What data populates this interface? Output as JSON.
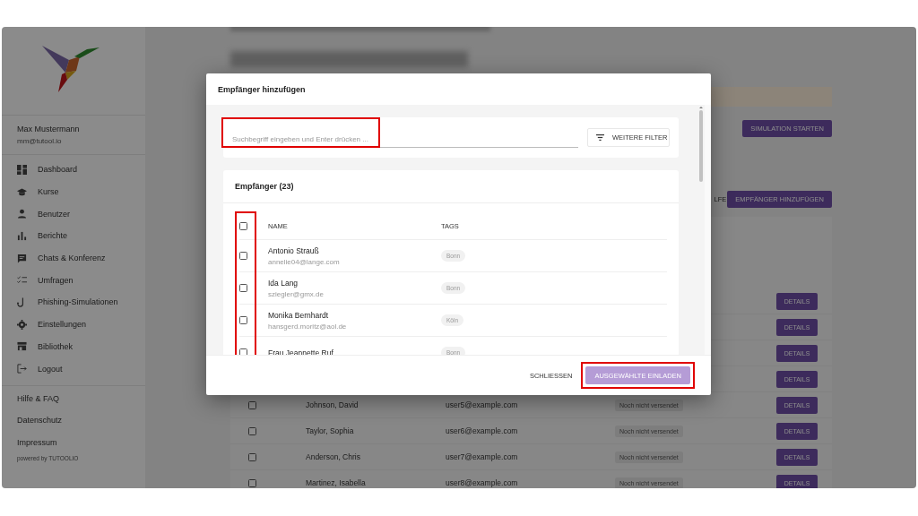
{
  "sidebar": {
    "user": {
      "name": "Max Mustermann",
      "email": "mm@tutool.io"
    },
    "nav": [
      {
        "label": "Dashboard"
      },
      {
        "label": "Kurse"
      },
      {
        "label": "Benutzer"
      },
      {
        "label": "Berichte"
      },
      {
        "label": "Chats & Konferenz"
      },
      {
        "label": "Umfragen"
      },
      {
        "label": "Phishing-Simulationen"
      },
      {
        "label": "Einstellungen"
      },
      {
        "label": "Bibliothek"
      },
      {
        "label": "Logout"
      }
    ],
    "footer_links": [
      "Hilfe & FAQ",
      "Datenschutz",
      "Impressum"
    ],
    "powered_by": "powered by TUTOOLIO"
  },
  "page": {
    "start_button": "SIMULATION STARTEN",
    "help_link_fragment": "LFE",
    "add_button": "EMPFÄNGER HINZUFÜGEN",
    "rows": [
      {
        "action": "DETAILS"
      },
      {
        "action": "DETAILS"
      },
      {
        "action": "DETAILS"
      },
      {
        "action": "DETAILS"
      },
      {
        "checked": false,
        "name": "Johnson, David",
        "email": "user5@example.com",
        "status": "Noch nicht versendet",
        "action": "DETAILS"
      },
      {
        "checked": false,
        "name": "Taylor, Sophia",
        "email": "user6@example.com",
        "status": "Noch nicht versendet",
        "action": "DETAILS"
      },
      {
        "checked": false,
        "name": "Anderson, Chris",
        "email": "user7@example.com",
        "status": "Noch nicht versendet",
        "action": "DETAILS"
      },
      {
        "checked": false,
        "name": "Martinez, Isabella",
        "email": "user8@example.com",
        "status": "Noch nicht versendet",
        "action": "DETAILS"
      }
    ]
  },
  "dialog": {
    "title": "Empfänger hinzufügen",
    "search": {
      "placeholder": "Suchbegriff eingeben und Enter drücken ..."
    },
    "filter_button": "WEITERE FILTER",
    "recipients": {
      "title": "Empfänger (23)",
      "select_all": {
        "checked": false
      },
      "columns": [
        "NAME",
        "TAGS"
      ],
      "rows": [
        {
          "checked": false,
          "name": "Antonio Strauß",
          "email": "annelie04@lange.com",
          "tag": "Bonn"
        },
        {
          "checked": false,
          "name": "Ida Lang",
          "email": "sziegler@gmx.de",
          "tag": "Bonn"
        },
        {
          "checked": false,
          "name": "Monika Bernhardt",
          "email": "hansgerd.moritz@aol.de",
          "tag": "Köln"
        },
        {
          "checked": false,
          "name": "Frau Jeannette Ruf",
          "tag": "Bonn"
        }
      ]
    },
    "buttons": [
      {
        "label": "SCHLIESSEN",
        "kind": "text"
      },
      {
        "label": "AUSGEWÄHLTE EINLADEN",
        "kind": "primary"
      }
    ]
  }
}
